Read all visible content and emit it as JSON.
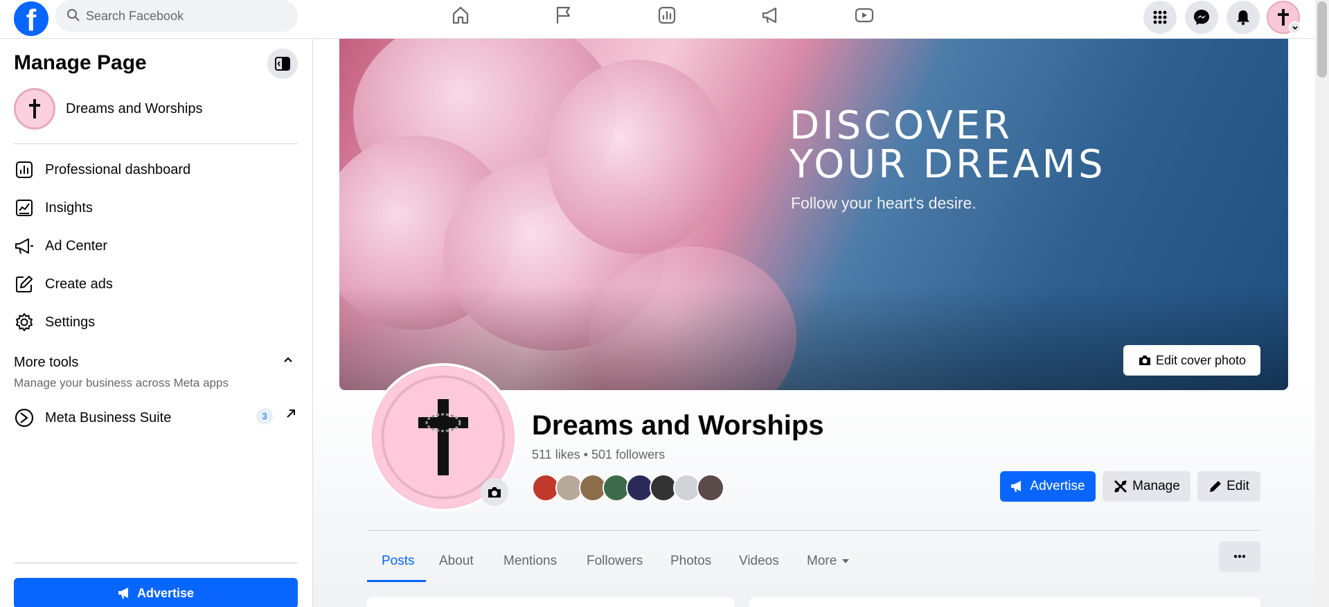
{
  "topbar": {
    "logo": "f",
    "search_placeholder": "Search Facebook",
    "nav_icons": [
      "home-icon",
      "flag-icon",
      "chart-icon",
      "megaphone-icon",
      "video-icon"
    ],
    "right_icons": [
      "menu-grid-icon",
      "messenger-icon",
      "bell-icon"
    ]
  },
  "sidebar": {
    "title": "Manage Page",
    "page_name": "Dreams and Worships",
    "items": [
      {
        "label": "Professional dashboard",
        "icon": "dashboard-icon"
      },
      {
        "label": "Insights",
        "icon": "insights-icon"
      },
      {
        "label": "Ad Center",
        "icon": "megaphone-icon"
      },
      {
        "label": "Create ads",
        "icon": "edit-icon"
      },
      {
        "label": "Settings",
        "icon": "gear-icon"
      }
    ],
    "more_tools": {
      "title": "More tools",
      "subtitle": "Manage your business across Meta apps"
    },
    "meta_business_suite": {
      "label": "Meta Business Suite",
      "badge": "3"
    },
    "advertise": "Advertise"
  },
  "cover": {
    "headline": "DISCOVER\nYOUR DREAMS",
    "tagline": "Follow your heart's desire.",
    "edit_button": "Edit cover photo"
  },
  "profile": {
    "name": "Dreams and Worships",
    "stats": "511 likes • 501 followers",
    "follower_avatar_colors": [
      "#c0392b",
      "#b8a89a",
      "#8d6e4c",
      "#3d6b4a",
      "#2a2a5a",
      "#333333",
      "#cfd2d6",
      "#5a4a4a"
    ]
  },
  "actions": {
    "advertise": "Advertise",
    "manage": "Manage",
    "edit": "Edit"
  },
  "tabs": [
    "Posts",
    "About",
    "Mentions",
    "Followers",
    "Photos",
    "Videos",
    "More"
  ],
  "active_tab": "Posts",
  "colors": {
    "brand": "#0866ff",
    "grey_button": "#e4e6eb",
    "text_secondary": "#65676b"
  }
}
